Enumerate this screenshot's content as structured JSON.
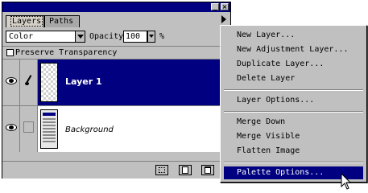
{
  "tabs": [
    "Layers",
    "Paths"
  ],
  "blend_mode": "Color",
  "opacity": {
    "label": "Opacity:",
    "value": "100",
    "unit": "%"
  },
  "preserve_transparency": {
    "label": "Preserve Transparency",
    "checked": false
  },
  "layers": [
    {
      "name": "Layer 1",
      "selected": true
    },
    {
      "name": "Background",
      "selected": false
    }
  ],
  "menu": {
    "group1": [
      "New Layer...",
      "New Adjustment Layer...",
      "Duplicate Layer...",
      "Delete Layer"
    ],
    "group2": [
      "Layer Options..."
    ],
    "group3": [
      "Merge Down",
      "Merge Visible",
      "Flatten Image"
    ],
    "group4": [
      "Palette Options..."
    ]
  },
  "colors": {
    "title_bar": "#000080",
    "selection": "#000080",
    "panel": "#c0c0c0"
  }
}
